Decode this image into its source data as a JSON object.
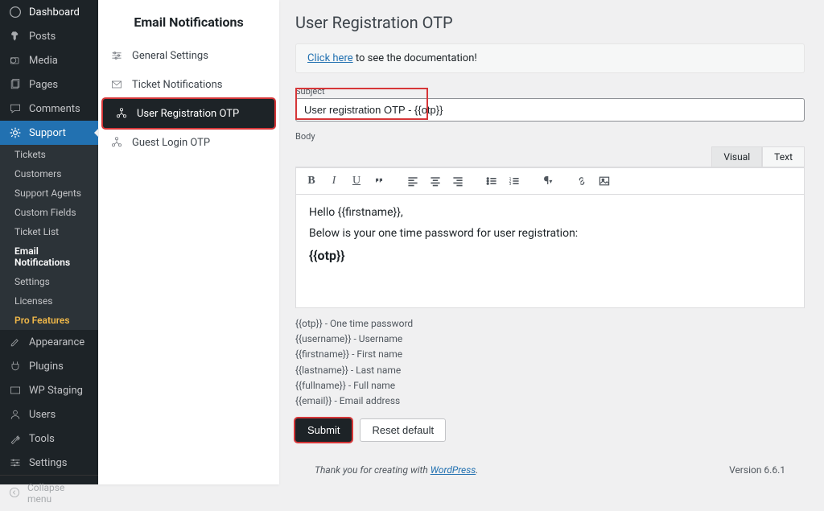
{
  "wp_sidebar": {
    "items": [
      {
        "label": "Dashboard",
        "icon": "dash"
      },
      {
        "label": "Posts",
        "icon": "pin"
      },
      {
        "label": "Media",
        "icon": "media"
      },
      {
        "label": "Pages",
        "icon": "page"
      },
      {
        "label": "Comments",
        "icon": "comment"
      },
      {
        "label": "Support",
        "icon": "gear",
        "active": true,
        "badge": true
      }
    ],
    "sub": [
      {
        "label": "Tickets"
      },
      {
        "label": "Customers"
      },
      {
        "label": "Support Agents"
      },
      {
        "label": "Custom Fields"
      },
      {
        "label": "Ticket List"
      },
      {
        "label": "Email Notifications",
        "current": true
      },
      {
        "label": "Settings"
      },
      {
        "label": "Licenses"
      },
      {
        "label": "Pro Features",
        "pro": true
      }
    ],
    "lower": [
      {
        "label": "Appearance",
        "icon": "brush"
      },
      {
        "label": "Plugins",
        "icon": "plug"
      },
      {
        "label": "WP Staging",
        "icon": "stage"
      },
      {
        "label": "Users",
        "icon": "user"
      },
      {
        "label": "Tools",
        "icon": "wrench"
      },
      {
        "label": "Settings",
        "icon": "sliders"
      }
    ],
    "collapse": "Collapse menu"
  },
  "panel": {
    "title": "Email Notifications",
    "items": [
      {
        "label": "General Settings",
        "icon": "sliders"
      },
      {
        "label": "Ticket Notifications",
        "icon": "mail"
      },
      {
        "label": "User Registration OTP",
        "icon": "network",
        "active": true,
        "highlight": true
      },
      {
        "label": "Guest Login OTP",
        "icon": "network"
      }
    ]
  },
  "main": {
    "title": "User Registration OTP",
    "doc_link": "Click here",
    "doc_rest": " to see the documentation!",
    "subject_label": "Subject",
    "subject_value": "User registration OTP - {{otp}}",
    "body_label": "Body",
    "tab_visual": "Visual",
    "tab_text": "Text",
    "body_line1": "Hello {{firstname}},",
    "body_line2": "Below is your one time password for user registration:",
    "body_otp": "{{otp}}",
    "hints": [
      "{{otp}} - One time password",
      "{{username}} - Username",
      "{{firstname}} - First name",
      "{{lastname}} - Last name",
      "{{fullname}} - Full name",
      "{{email}} - Email address"
    ],
    "submit": "Submit",
    "reset": "Reset default"
  },
  "footer": {
    "thanks_pre": "Thank you for creating with ",
    "thanks_link": "WordPress",
    "version": "Version 6.6.1"
  }
}
